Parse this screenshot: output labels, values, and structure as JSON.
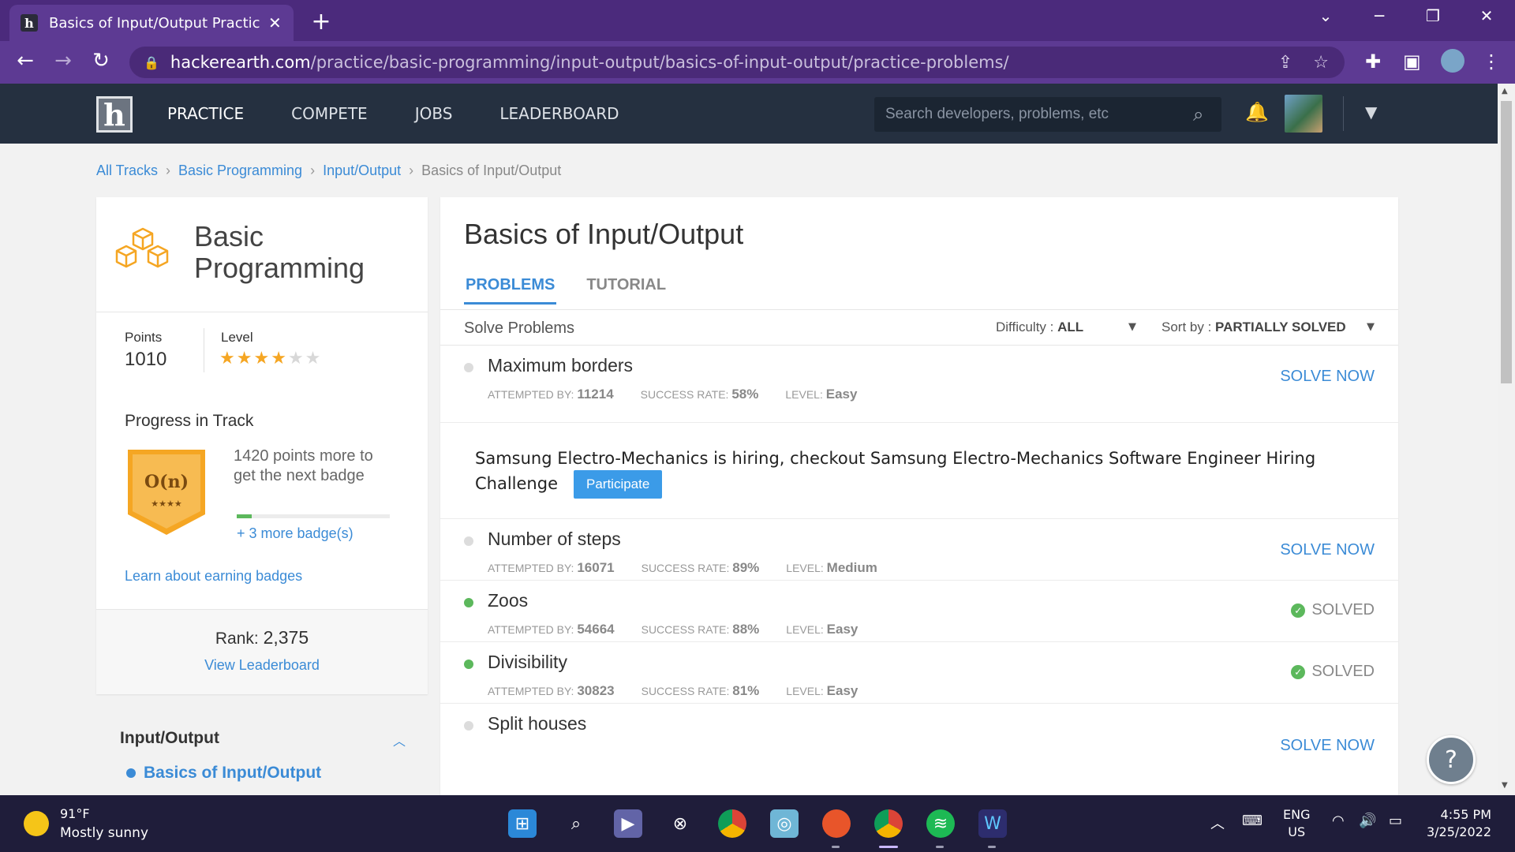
{
  "browser": {
    "tab_title": "Basics of Input/Output Practice P",
    "url_host": "hackerearth.com",
    "url_path": "/practice/basic-programming/input-output/basics-of-input-output/practice-problems/"
  },
  "header": {
    "logo_letter": "h",
    "nav": [
      "PRACTICE",
      "COMPETE",
      "JOBS",
      "LEADERBOARD"
    ],
    "search_placeholder": "Search developers, problems, etc"
  },
  "breadcrumb": [
    "All Tracks",
    "Basic Programming",
    "Input/Output",
    "Basics of Input/Output"
  ],
  "track": {
    "title": "Basic Programming",
    "points_label": "Points",
    "points_value": "1010",
    "level_label": "Level",
    "level_stars_filled": 4,
    "level_stars_total": 6,
    "progress_title": "Progress in Track",
    "badge_symbol": "O(n)",
    "badge_stars": "★★★★",
    "next_badge_text": "1420 points more to get the next badge",
    "progress_fraction": 0.1,
    "more_badges": "+ 3 more badge(s)",
    "learn_link": "Learn about earning badges",
    "rank_label": "Rank:",
    "rank_value": "2,375",
    "view_leaderboard": "View Leaderboard"
  },
  "subtopics": {
    "title": "Input/Output",
    "current": "Basics of Input/Output"
  },
  "main": {
    "title": "Basics of Input/Output",
    "tabs": [
      "PROBLEMS",
      "TUTORIAL"
    ],
    "solve_label": "Solve Problems",
    "difficulty_label": "Difficulty :",
    "difficulty_value": "ALL",
    "sort_label": "Sort by :",
    "sort_value": "PARTIALLY SOLVED",
    "meta_labels": {
      "attempted": "ATTEMPTED BY:",
      "success": "SUCCESS RATE:",
      "level": "LEVEL:"
    },
    "problems": [
      {
        "name": "Maximum borders",
        "attempted": "11214",
        "success": "58%",
        "level": "Easy",
        "status": "SOLVE NOW"
      },
      {
        "name": "Number of steps",
        "attempted": "16071",
        "success": "89%",
        "level": "Medium",
        "status": "SOLVE NOW"
      },
      {
        "name": "Zoos",
        "attempted": "54664",
        "success": "88%",
        "level": "Easy",
        "status": "SOLVED"
      },
      {
        "name": "Divisibility",
        "attempted": "30823",
        "success": "81%",
        "level": "Easy",
        "status": "SOLVED"
      },
      {
        "name": "Split houses",
        "status": "SOLVE NOW"
      }
    ],
    "promo_text": "Samsung Electro-Mechanics is hiring, checkout Samsung Electro-Mechanics Software Engineer Hiring Challenge",
    "promo_button": "Participate"
  },
  "taskbar": {
    "temperature": "91°F",
    "weather": "Mostly sunny",
    "lang_line1": "ENG",
    "lang_line2": "US",
    "time": "4:55 PM",
    "date": "3/25/2022"
  }
}
